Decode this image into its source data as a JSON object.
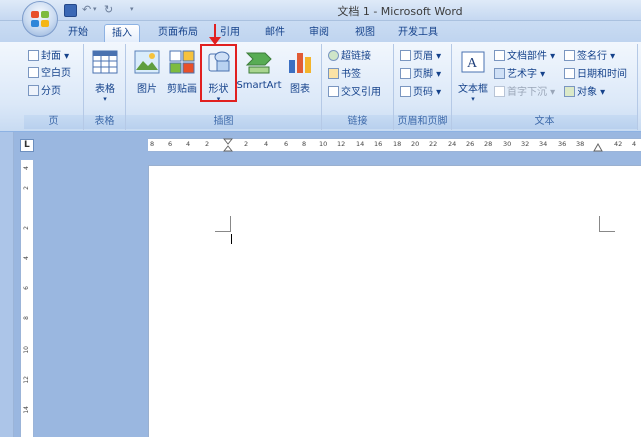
{
  "window": {
    "title": "文档 1 - Microsoft Word"
  },
  "tabs": [
    "开始",
    "插入",
    "页面布局",
    "引用",
    "邮件",
    "审阅",
    "视图",
    "开发工具"
  ],
  "ribbon": {
    "pages": {
      "label": "页",
      "items": [
        "封面 ▾",
        "空白页",
        "分页"
      ]
    },
    "tables": {
      "label": "表格",
      "item": "表格"
    },
    "illustrations": {
      "label": "插图",
      "items": [
        "图片",
        "剪贴画",
        "形状",
        "SmartArt",
        "图表"
      ]
    },
    "links": {
      "label": "链接",
      "items": [
        "超链接",
        "书签",
        "交叉引用"
      ]
    },
    "header_footer": {
      "label": "页眉和页脚",
      "items": [
        "页眉 ▾",
        "页脚 ▾",
        "页码 ▾"
      ]
    },
    "text": {
      "label": "文本",
      "text_box": "文本框",
      "items": [
        "文档部件 ▾",
        "艺术字 ▾",
        "首字下沉 ▾",
        "签名行 ▾",
        "日期和时间",
        "对象 ▾"
      ]
    }
  },
  "ruler": {
    "corner": "L",
    "h_ticks": [
      "8",
      "6",
      "4",
      "2",
      "2",
      "4",
      "6",
      "8",
      "10",
      "12",
      "14",
      "16",
      "18",
      "20",
      "22",
      "24",
      "26",
      "28",
      "30",
      "32",
      "34",
      "36",
      "38",
      "42",
      "4"
    ],
    "v_ticks": [
      "4",
      "2",
      "2",
      "4",
      "6",
      "8",
      "10",
      "12",
      "14"
    ]
  },
  "colors": {
    "accent_red": "#e12020",
    "ribbon_text": "#15428b"
  }
}
